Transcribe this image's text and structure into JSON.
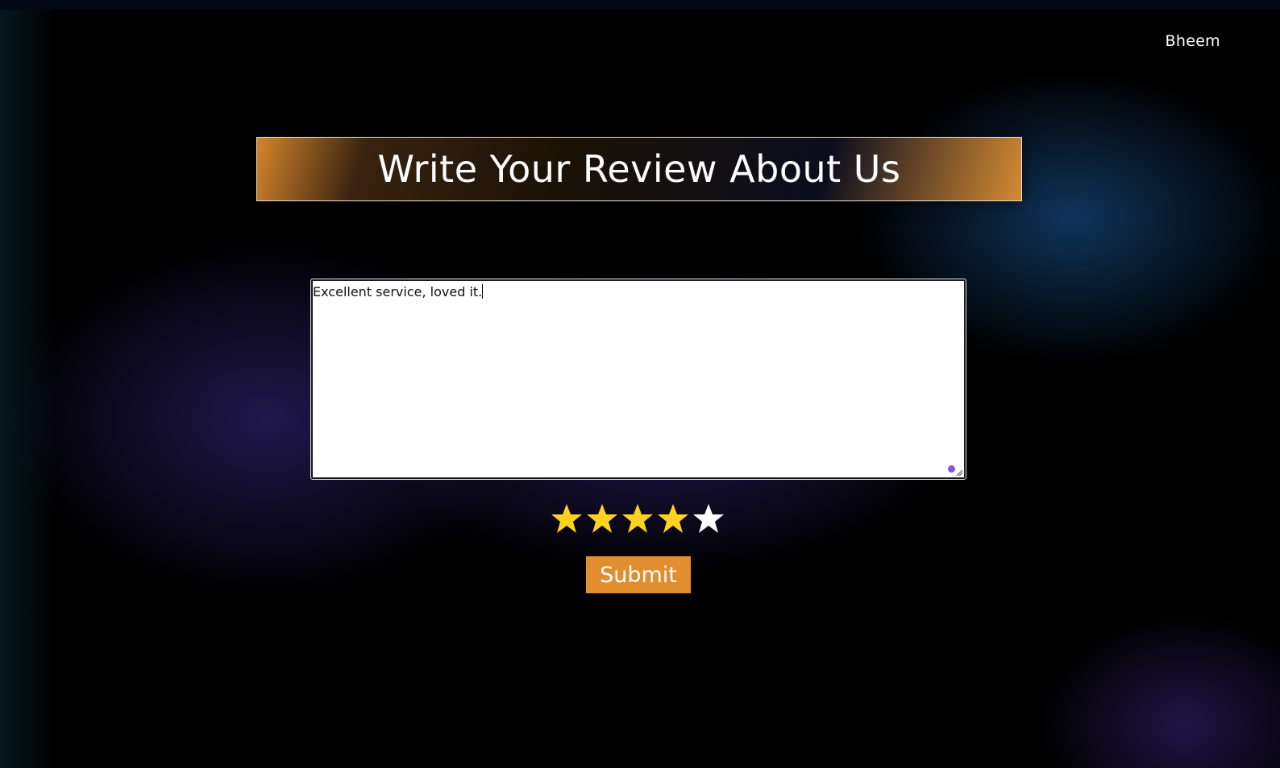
{
  "header": {
    "user_name": "Bheem"
  },
  "main": {
    "title": "Write Your Review About Us",
    "review": {
      "value": "Excellent service, loved it."
    },
    "rating": {
      "value": 4,
      "max": 5,
      "filled_color": "#ffd21f",
      "empty_color": "#ffffff"
    },
    "submit_label": "Submit"
  },
  "colors": {
    "accent": "#e08e30",
    "background": "#000000"
  }
}
